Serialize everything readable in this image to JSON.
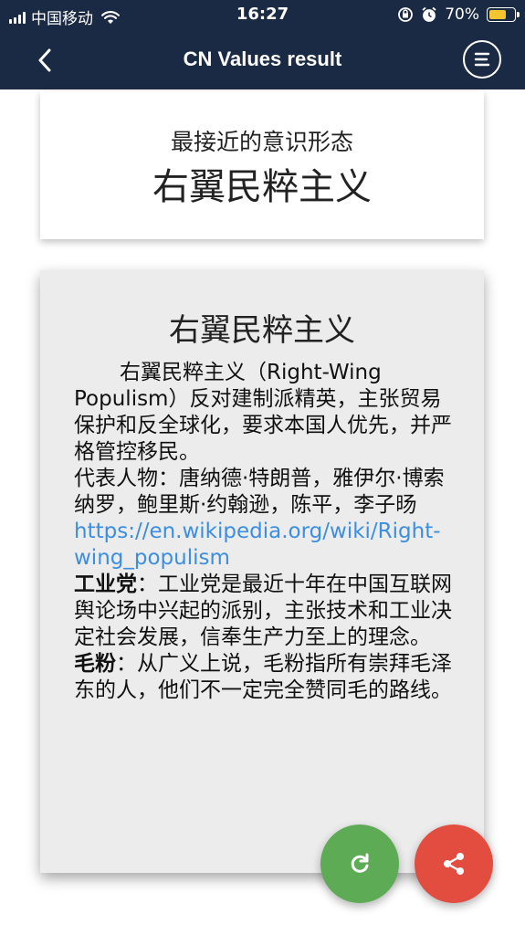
{
  "status_bar": {
    "carrier": "中国移动",
    "time": "16:27",
    "battery_percent": "70%",
    "battery_level": 0.7,
    "battery_color": "#f5c431"
  },
  "header": {
    "title": "CN Values result",
    "back_icon": "chevron-left-icon",
    "menu_icon": "menu-icon",
    "background": "#1b2a44"
  },
  "closest": {
    "subtitle": "最接近的意识形态",
    "ideology": "右翼民粹主义"
  },
  "detail": {
    "heading": "右翼民粹主义",
    "description": "右翼民粹主义（Right-Wing Populism）反对建制派精英，主张贸易保护和反全球化，要求本国人优先，并严格管控移民。",
    "representatives": "代表人物：唐纳德·特朗普，雅伊尔·博索纳罗，鲍里斯·约翰逊，陈平，李子旸",
    "link": "https://en.wikipedia.org/wiki/Right-wing_populism",
    "term1_name": "工业党",
    "term1_text": "：工业党是最近十年在中国互联网舆论场中兴起的派别，主张技术和工业决定社会发展，信奉生产力至上的理念。",
    "term2_name": "毛粉",
    "term2_text": "：从广义上说，毛粉指所有崇拜毛泽东的人，他们不一定完全赞同毛的路线。"
  },
  "actions": {
    "refresh_icon": "refresh-icon",
    "share_icon": "share-icon",
    "refresh_color": "#5eab55",
    "share_color": "#e24d3f",
    "link_color": "#3b8ee0"
  }
}
